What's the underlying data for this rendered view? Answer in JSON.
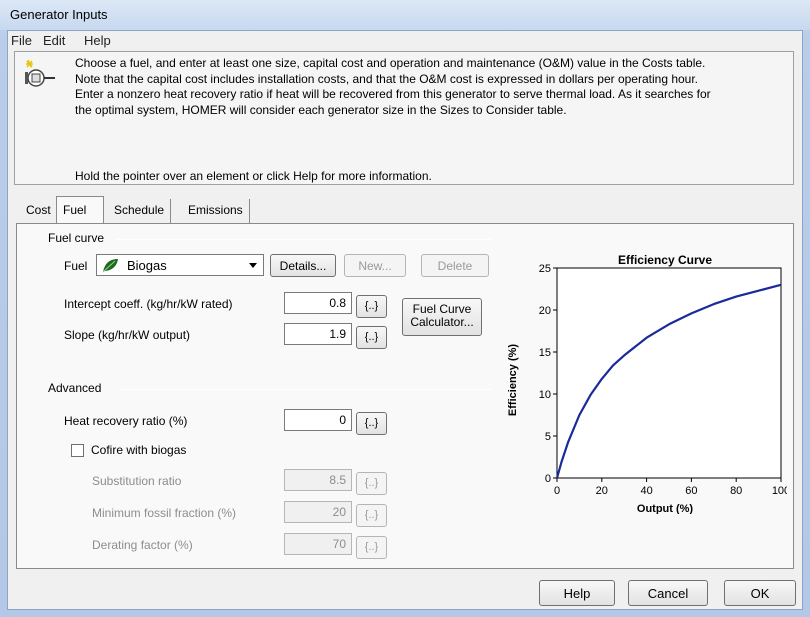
{
  "window": {
    "title": "Generator Inputs"
  },
  "menu": {
    "file": "File",
    "edit": "Edit",
    "help": "Help"
  },
  "info": {
    "icon": "generator-icon",
    "lines": [
      "Choose a fuel, and enter at least one size, capital cost and operation and maintenance (O&M) value in the Costs table.",
      "Note that the capital cost includes installation costs, and that the O&M cost is expressed in dollars per operating hour.",
      "Enter a nonzero heat recovery ratio if heat will be recovered from this generator to serve thermal load. As it searches for",
      "the optimal system, HOMER will consider each generator size in the Sizes to Consider table."
    ],
    "hold": "Hold the pointer over an element or click Help for more information."
  },
  "tabs": {
    "cost": "Cost",
    "fuel": "Fuel",
    "schedule": "Schedule",
    "emissions": "Emissions",
    "active": "Fuel"
  },
  "fuel_curve": {
    "group": "Fuel curve",
    "fuel_label": "Fuel",
    "fuel_value": "Biogas",
    "details": "Details...",
    "new": "New...",
    "delete": "Delete",
    "intercept_label": "Intercept coeff. (kg/hr/kW rated)",
    "intercept_value": "0.8",
    "slope_label": "Slope (kg/hr/kW output)",
    "slope_value": "1.9",
    "sens": "{..}",
    "calc_line1": "Fuel Curve",
    "calc_line2": "Calculator..."
  },
  "advanced": {
    "group": "Advanced",
    "heat_label": "Heat recovery ratio (%)",
    "heat_value": "0",
    "cofire_label": "Cofire with biogas",
    "cofire_checked": false,
    "sub_label": "Substitution ratio",
    "sub_value": "8.5",
    "minfossil_label": "Minimum fossil fraction (%)",
    "minfossil_value": "20",
    "derating_label": "Derating factor (%)",
    "derating_value": "70"
  },
  "buttons": {
    "help": "Help",
    "cancel": "Cancel",
    "ok": "OK"
  },
  "chart_data": {
    "type": "line",
    "title": "Efficiency Curve",
    "xlabel": "Output (%)",
    "ylabel": "Efficiency (%)",
    "xlim": [
      0,
      100
    ],
    "ylim": [
      0,
      25
    ],
    "xticks": [
      0,
      20,
      40,
      60,
      80,
      100
    ],
    "yticks": [
      0,
      5,
      10,
      15,
      20,
      25
    ],
    "grid": false,
    "color": "#1a2a9c",
    "series": [
      {
        "x": [
          0,
          2,
          5,
          10,
          15,
          20,
          25,
          30,
          40,
          50,
          60,
          70,
          80,
          90,
          100
        ],
        "values": [
          0,
          1.9,
          4.3,
          7.5,
          9.9,
          11.8,
          13.4,
          14.6,
          16.7,
          18.3,
          19.6,
          20.7,
          21.6,
          22.3,
          23.0
        ]
      }
    ]
  }
}
